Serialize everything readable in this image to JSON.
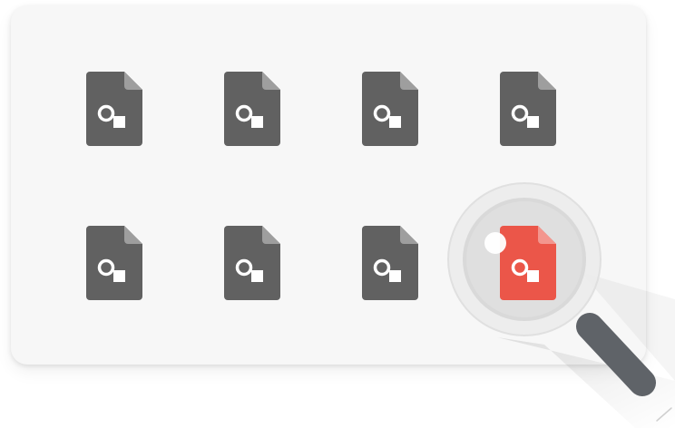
{
  "colors": {
    "background": "#ffffff",
    "card": "#f7f7f7",
    "file_default": "#616161",
    "file_fold": "#9e9e9e",
    "file_highlight": "#e94335",
    "file_highlight_fold": "#f28b82",
    "glyph": "#ffffff",
    "lens_rim": "#e6e6e6",
    "handle": "#616161"
  },
  "grid": {
    "rows": 2,
    "columns": 4,
    "icon": "drawing-file-icon",
    "highlighted": {
      "row": 2,
      "column": 4
    }
  },
  "magnifier": {
    "icon": "magnifier-icon",
    "target": "highlighted-drawing-file-icon"
  }
}
